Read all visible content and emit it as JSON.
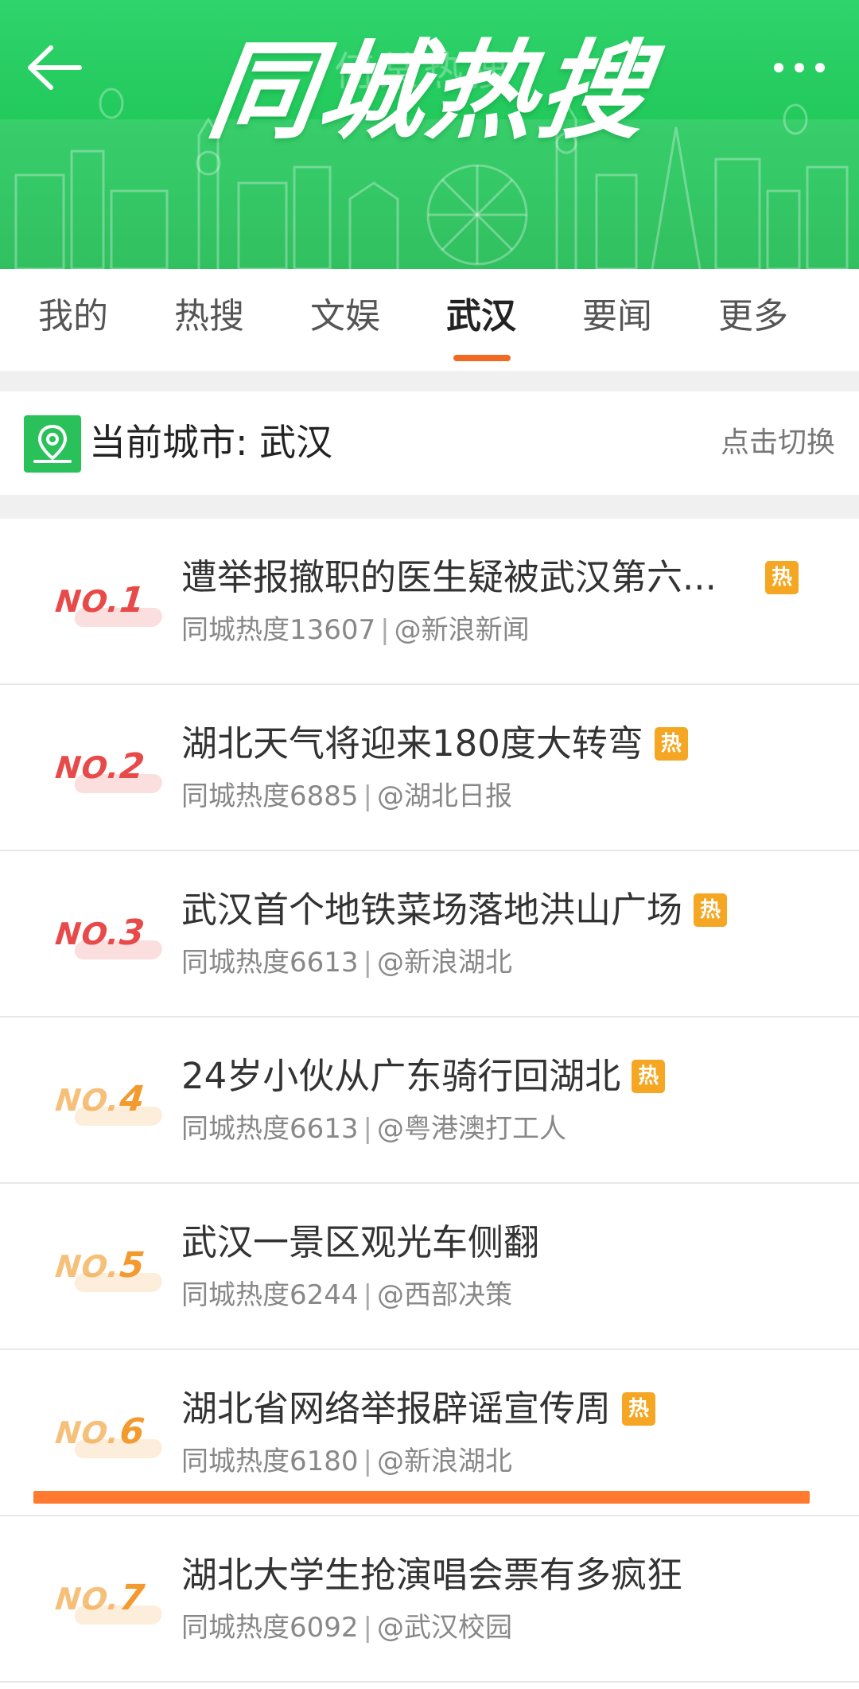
{
  "header": {
    "title": "同城热搜",
    "ghost_text": "何某热搜",
    "back_icon": "arrow-left-icon",
    "more_icon": "more-dots-icon"
  },
  "tabs": [
    {
      "label": "我的"
    },
    {
      "label": "热搜"
    },
    {
      "label": "文娱"
    },
    {
      "label": "武汉",
      "active": true
    },
    {
      "label": "要闻"
    },
    {
      "label": "更多"
    }
  ],
  "city": {
    "icon": "location-pin-icon",
    "label": "当前城市: 武汉",
    "switch_label": "点击切换"
  },
  "items": [
    {
      "no_prefix": "NO.",
      "rank": "1",
      "title": "遭举报撤职的医生疑被武汉第六...",
      "hot": true,
      "heat": "同城热度13607",
      "sep": "|",
      "source": "@新浪新闻",
      "style": "red"
    },
    {
      "no_prefix": "NO.",
      "rank": "2",
      "title": "湖北天气将迎来180度大转弯",
      "hot": true,
      "heat": "同城热度6885",
      "sep": "|",
      "source": "@湖北日报",
      "style": "red"
    },
    {
      "no_prefix": "NO.",
      "rank": "3",
      "title": "武汉首个地铁菜场落地洪山广场",
      "hot": true,
      "heat": "同城热度6613",
      "sep": "|",
      "source": "@新浪湖北",
      "style": "red"
    },
    {
      "no_prefix": "NO.",
      "rank": "4",
      "title": "24岁小伙从广东骑行回湖北",
      "hot": true,
      "heat": "同城热度6613",
      "sep": "|",
      "source": "@粤港澳打工人",
      "style": "orange"
    },
    {
      "no_prefix": "NO.",
      "rank": "5",
      "title": "武汉一景区观光车侧翻",
      "hot": false,
      "heat": "同城热度6244",
      "sep": "|",
      "source": "@西部决策",
      "style": "orange"
    },
    {
      "no_prefix": "NO.",
      "rank": "6",
      "title": "湖北省网络举报辟谣宣传周",
      "hot": true,
      "heat": "同城热度6180",
      "sep": "|",
      "source": "@新浪湖北",
      "style": "orange"
    },
    {
      "no_prefix": "NO.",
      "rank": "7",
      "title": "湖北大学生抢演唱会票有多疯狂",
      "hot": false,
      "heat": "同城热度6092",
      "sep": "|",
      "source": "@武汉校园",
      "style": "orange"
    }
  ],
  "hot_badge_label": "热",
  "colors": {
    "banner_green": "#22c95b",
    "tab_indicator": "#f26a21",
    "hot_badge": "#f5a623",
    "rank_red": "#e84a4a",
    "rank_orange": "#f39a2f",
    "highlight_line": "#ff7a2e"
  }
}
